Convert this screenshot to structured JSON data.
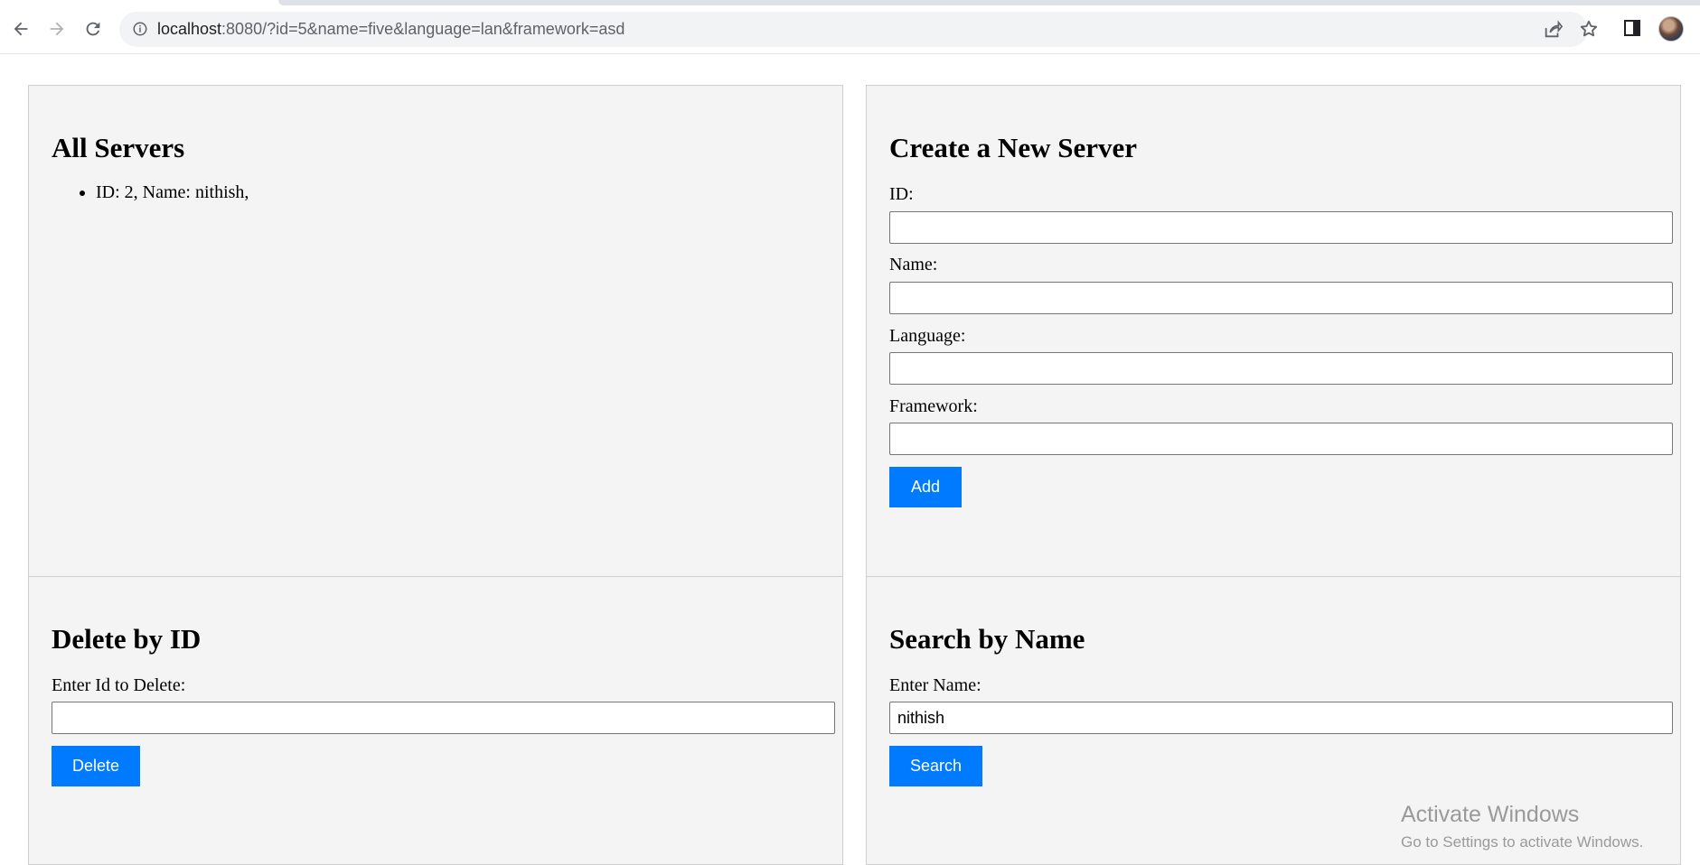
{
  "browser": {
    "url_host": "localhost",
    "url_rest": ":8080/?id=5&name=five&language=lan&framework=asd"
  },
  "all_servers": {
    "title": "All Servers",
    "items": [
      "ID: 2, Name: nithish,"
    ]
  },
  "create": {
    "title": "Create a New Server",
    "id_label": "ID:",
    "id_value": "",
    "name_label": "Name:",
    "name_value": "",
    "language_label": "Language:",
    "language_value": "",
    "framework_label": "Framework:",
    "framework_value": "",
    "add_label": "Add"
  },
  "delete": {
    "title": "Delete by ID",
    "id_label": "Enter Id to Delete:",
    "id_value": "",
    "button_label": "Delete"
  },
  "search": {
    "title": "Search by Name",
    "name_label": "Enter Name:",
    "name_value": "nithish",
    "button_label": "Search"
  },
  "watermark": {
    "title": "Activate Windows",
    "subtitle": "Go to Settings to activate Windows."
  },
  "colors": {
    "button": "#007bff",
    "panel": "#f4f4f4"
  },
  "icons": [
    "back-arrow-icon",
    "forward-arrow-icon",
    "reload-icon",
    "info-icon",
    "share-icon",
    "star-icon",
    "side-panel-icon"
  ]
}
